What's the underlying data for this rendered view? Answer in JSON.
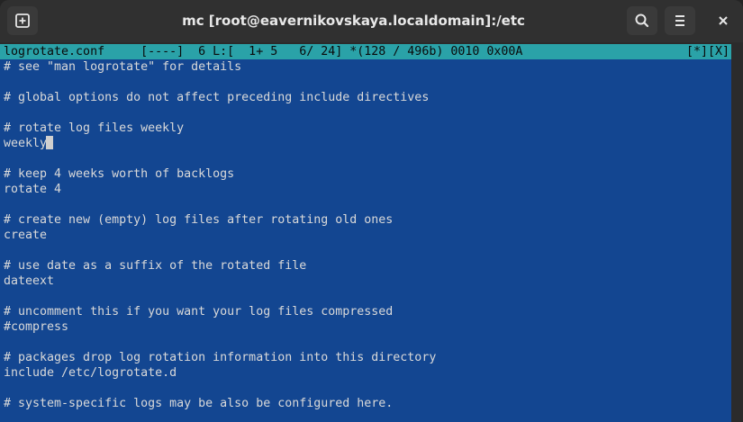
{
  "window": {
    "title": "mc [root@eavernikovskaya.localdomain]:/etc"
  },
  "titlebar": {
    "new_tab_icon": "new-tab-icon",
    "search_icon": "search-icon",
    "menu_icon": "hamburger-menu-icon",
    "close_icon": "close-icon"
  },
  "editor": {
    "status_left": "logrotate.conf     [----]  6 L:[  1+ 5   6/ 24] *(128 / 496b) 0010 0x00A",
    "status_right": "[*][X]",
    "lines": [
      "# see \"man logrotate\" for details",
      "",
      "# global options do not affect preceding include directives",
      "",
      "# rotate log files weekly",
      "weekly",
      "",
      "# keep 4 weeks worth of backlogs",
      "rotate 4",
      "",
      "# create new (empty) log files after rotating old ones",
      "create",
      "",
      "# use date as a suffix of the rotated file",
      "dateext",
      "",
      "# uncomment this if you want your log files compressed",
      "#compress",
      "",
      "# packages drop log rotation information into this directory",
      "include /etc/logrotate.d",
      "",
      "# system-specific logs may be also be configured here."
    ]
  },
  "colors": {
    "titlebar": "#303030",
    "status_bar": "#2aa2a8",
    "editor_background": "#134691",
    "editor_text": "#d9d9d9"
  }
}
